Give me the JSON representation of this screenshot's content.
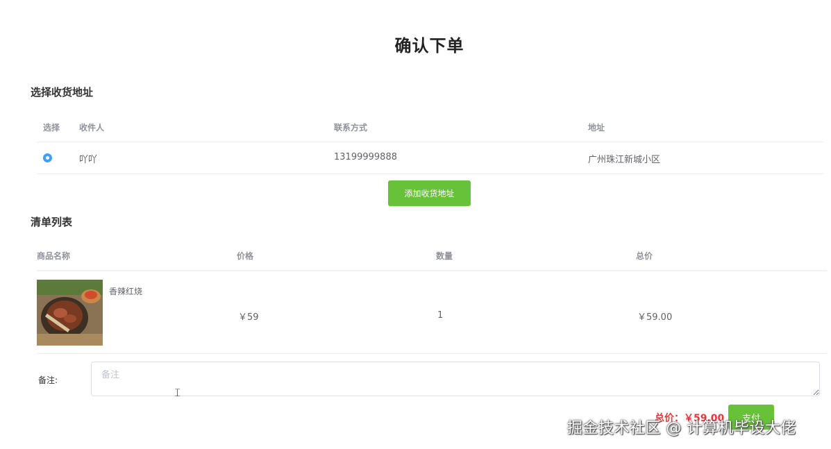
{
  "page": {
    "title": "确认下单"
  },
  "address_section": {
    "title": "选择收货地址",
    "headers": {
      "select": "选择",
      "receiver": "收件人",
      "phone": "联系方式",
      "address": "地址"
    },
    "rows": [
      {
        "selected": true,
        "receiver": "吖吖",
        "phone": "13199999888",
        "address": "广州珠江新城小区"
      }
    ],
    "add_button": "添加收货地址"
  },
  "order_section": {
    "title": "清单列表",
    "headers": {
      "name": "商品名称",
      "price": "价格",
      "quantity": "数量",
      "subtotal": "总价"
    },
    "items": [
      {
        "name": "香辣红烧",
        "price": "￥59",
        "quantity": "1",
        "subtotal": "￥59.00",
        "image": "food-photo"
      }
    ]
  },
  "remark": {
    "label": "备注:",
    "placeholder": "备注",
    "value": ""
  },
  "summary": {
    "total": "总价：￥59.00",
    "pay_button": "支付"
  },
  "watermark": "掘金技术社区 @ 计算机毕设大佬",
  "colors": {
    "primary_green": "#67c23a",
    "radio_blue": "#409eff",
    "total_red": "#e4393c"
  }
}
